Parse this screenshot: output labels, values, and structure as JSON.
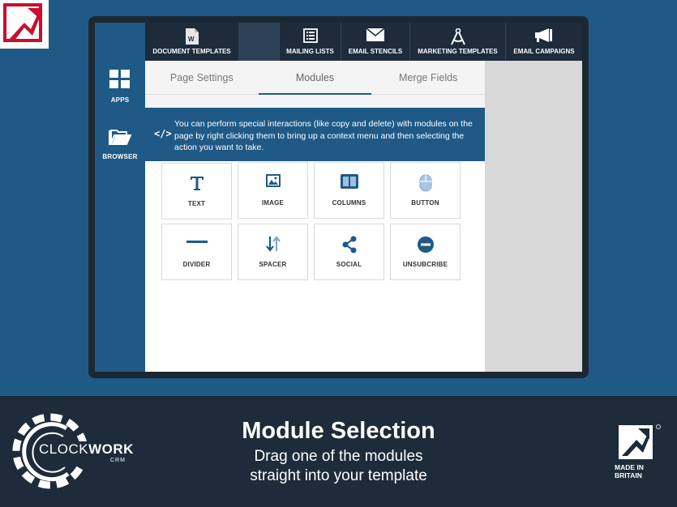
{
  "nav": {
    "items": [
      {
        "label": "DOCUMENT TEMPLATES",
        "icon": "word-document-icon"
      },
      {
        "label": "",
        "icon": ""
      },
      {
        "label": "MAILING LISTS",
        "icon": "list-icon"
      },
      {
        "label": "EMAIL STENCILS",
        "icon": "envelope-icon"
      },
      {
        "label": "MARKETING TEMPLATES",
        "icon": "compass-icon"
      },
      {
        "label": "EMAIL CAMPAIGNS",
        "icon": "megaphone-icon"
      }
    ]
  },
  "rail": {
    "apps_label": "APPS",
    "browser_label": "BROWSER"
  },
  "tabs": {
    "page_settings": "Page Settings",
    "modules": "Modules",
    "merge_fields": "Merge Fields",
    "active": "Modules"
  },
  "info": {
    "text": "You can perform special interactions (like copy and delete) with modules on the page by right clicking them to bring up a context menu and then selecting the action you want to take."
  },
  "modules": [
    {
      "label": "TEXT",
      "icon": "text-icon"
    },
    {
      "label": "IMAGE",
      "icon": "image-icon"
    },
    {
      "label": "COLUMNS",
      "icon": "columns-icon"
    },
    {
      "label": "BUTTON",
      "icon": "mouse-icon"
    },
    {
      "label": "DIVIDER",
      "icon": "divider-icon"
    },
    {
      "label": "SPACER",
      "icon": "spacer-arrows-icon"
    },
    {
      "label": "SOCIAL",
      "icon": "share-icon"
    },
    {
      "label": "UNSUBCRIBE",
      "icon": "minus-circle-icon"
    }
  ],
  "footer": {
    "title": "Module Selection",
    "subtitle_line1": "Drag one of the modules",
    "subtitle_line2": "straight into your template",
    "brand_part1": "CLOCK",
    "brand_part2": "WORK",
    "brand_suffix": "CRM",
    "badge_line1": "MADE IN",
    "badge_line2": "BRITAIN"
  },
  "colors": {
    "background": "#1f5a86",
    "nav": "#1d2b3a",
    "accent": "#1f5a86",
    "footer": "#1d2b3a"
  }
}
